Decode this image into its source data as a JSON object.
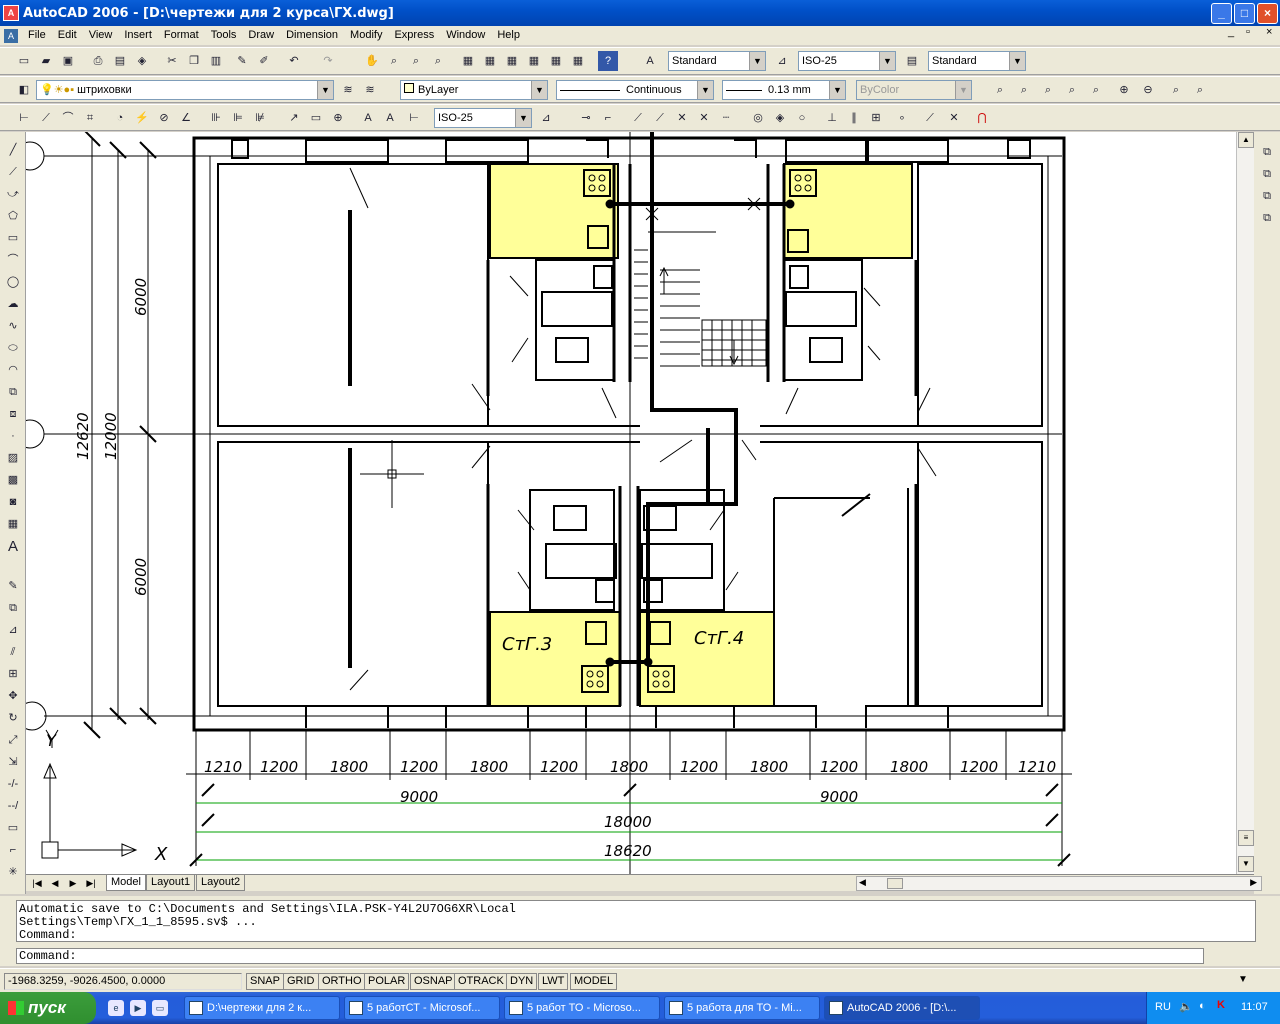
{
  "window": {
    "title": "AutoCAD 2006 - [D:\\чертежи для 2 курса\\ГХ.dwg]"
  },
  "menu": [
    "File",
    "Edit",
    "View",
    "Insert",
    "Format",
    "Tools",
    "Draw",
    "Dimension",
    "Modify",
    "Express",
    "Window",
    "Help"
  ],
  "toolbar1": {
    "text_style": "Standard",
    "dim_style": "ISO-25",
    "table_style": "Standard"
  },
  "toolbar2": {
    "layer": "штриховки",
    "color": "ByLayer",
    "linetype": "Continuous",
    "lineweight": "0.13 mm",
    "plotstyle": "ByColor"
  },
  "toolbar3": {
    "dim_style": "ISO-25"
  },
  "drawing": {
    "dims_bottom": [
      "1210",
      "1200",
      "1800",
      "1200",
      "1800",
      "1200",
      "1800",
      "1200",
      "1800",
      "1200",
      "1800",
      "1200",
      "1210"
    ],
    "dims_half": [
      "9000",
      "9000"
    ],
    "dim_total_inner": "18000",
    "dim_total_outer": "18620",
    "dims_left": [
      "6000",
      "6000",
      "12000",
      "12620"
    ],
    "riser_labels": [
      "СтГ.3",
      "СтГ.4"
    ],
    "ucs_x": "X",
    "ucs_y": "Y"
  },
  "layout_tabs": [
    "Model",
    "Layout1",
    "Layout2"
  ],
  "command": {
    "history": "Automatic save to C:\\Documents and Settings\\ILA.PSK-Y4L2U7OG6XR\\Local\nSettings\\Temp\\ГХ_1_1_8595.sv$ ...\nCommand:",
    "prompt": "Command:"
  },
  "status": {
    "coordinates": "-1968.3259, -9026.4500, 0.0000",
    "toggles": [
      "SNAP",
      "GRID",
      "ORTHO",
      "POLAR",
      "OSNAP",
      "OTRACK",
      "DYN",
      "LWT",
      "MODEL"
    ]
  },
  "taskbar": {
    "start": "пуск",
    "items": [
      "D:\\чертежи для 2 к...",
      "5 работСТ - Microsof...",
      "5 работ ТО - Microso...",
      "5 работа для ТО - Mi...",
      "AutoCAD 2006 - [D:\\..."
    ],
    "lang": "RU",
    "clock": "11:07"
  },
  "colors": {
    "titlebar": "#0054e3",
    "highlight": "#ffff99",
    "taskbar": "#245edb",
    "start": "#3c9d3c",
    "dim_green": "#00a000"
  }
}
